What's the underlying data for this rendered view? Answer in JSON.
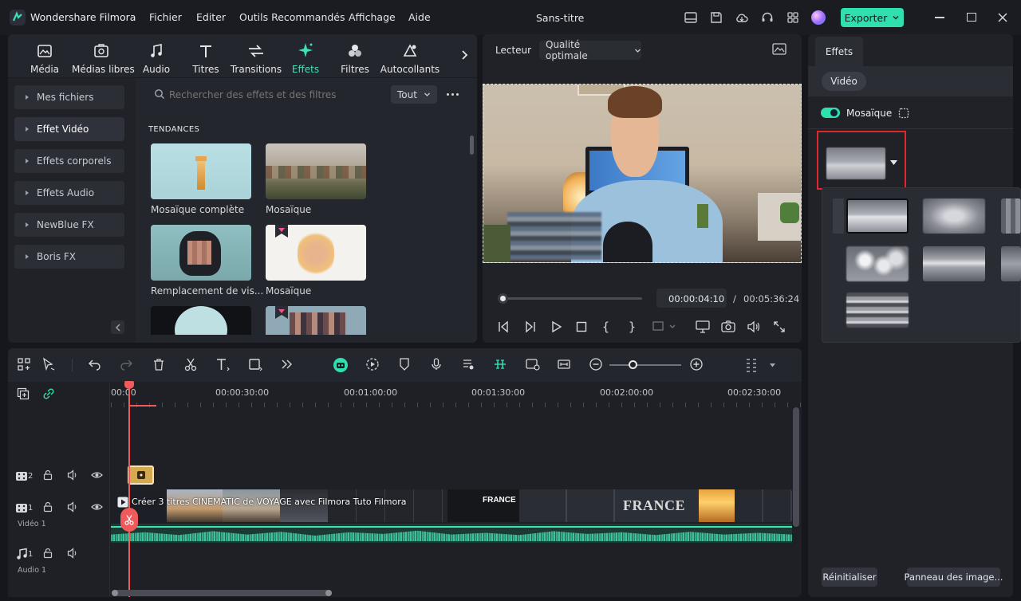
{
  "app": {
    "title": "Wondershare Filmora",
    "document_title": "Sans-titre",
    "export_label": "Exporter"
  },
  "menu": [
    "Fichier",
    "Editer",
    "Outils Recommandés",
    "Affichage",
    "Aide"
  ],
  "media_tabs": [
    "Média",
    "Médias libres",
    "Audio",
    "Titres",
    "Transitions",
    "Effets",
    "Filtres",
    "Autocollants"
  ],
  "sidebar": [
    "Mes fichiers",
    "Effet Vidéo",
    "Effets corporels",
    "Effets Audio",
    "NewBlue FX",
    "Boris FX"
  ],
  "search": {
    "placeholder": "Rechercher des effets et des filtres",
    "filter": "Tout"
  },
  "section_title": "TENDANCES",
  "effects": [
    "Mosaïque complète",
    "Mosaïque",
    "Remplacement de vis...",
    "Mosaïque"
  ],
  "player": {
    "label": "Lecteur",
    "quality": "Qualité optimale",
    "current_time": "00:00:04:10",
    "separator": "/",
    "total_time": "00:05:36:24"
  },
  "ruler": [
    "00:00",
    "00:00:30:00",
    "00:01:00:00",
    "00:01:30:00",
    "00:02:00:00",
    "00:02:30:00"
  ],
  "tracks": {
    "video2_num": "2",
    "video1_num": "1",
    "video1_label": "Vidéo 1",
    "audio1_num": "1",
    "audio1_label": "Audio 1",
    "clip_title": "Créer 3 titres CINEMATIC de VOYAGE avec Filmora  Tuto Filmora",
    "clip_text_1": "FRANCE",
    "clip_text_2": "FRANCE"
  },
  "right_panel": {
    "tab": "Effets",
    "subtab": "Vidéo",
    "toggle_label": "Mosaïque",
    "reset": "Réinitialiser",
    "keyframe": "Panneau des image..."
  },
  "colors": {
    "accent": "#2fdfae",
    "playhead": "#f05a5a",
    "highlight_box": "#e0262e"
  }
}
